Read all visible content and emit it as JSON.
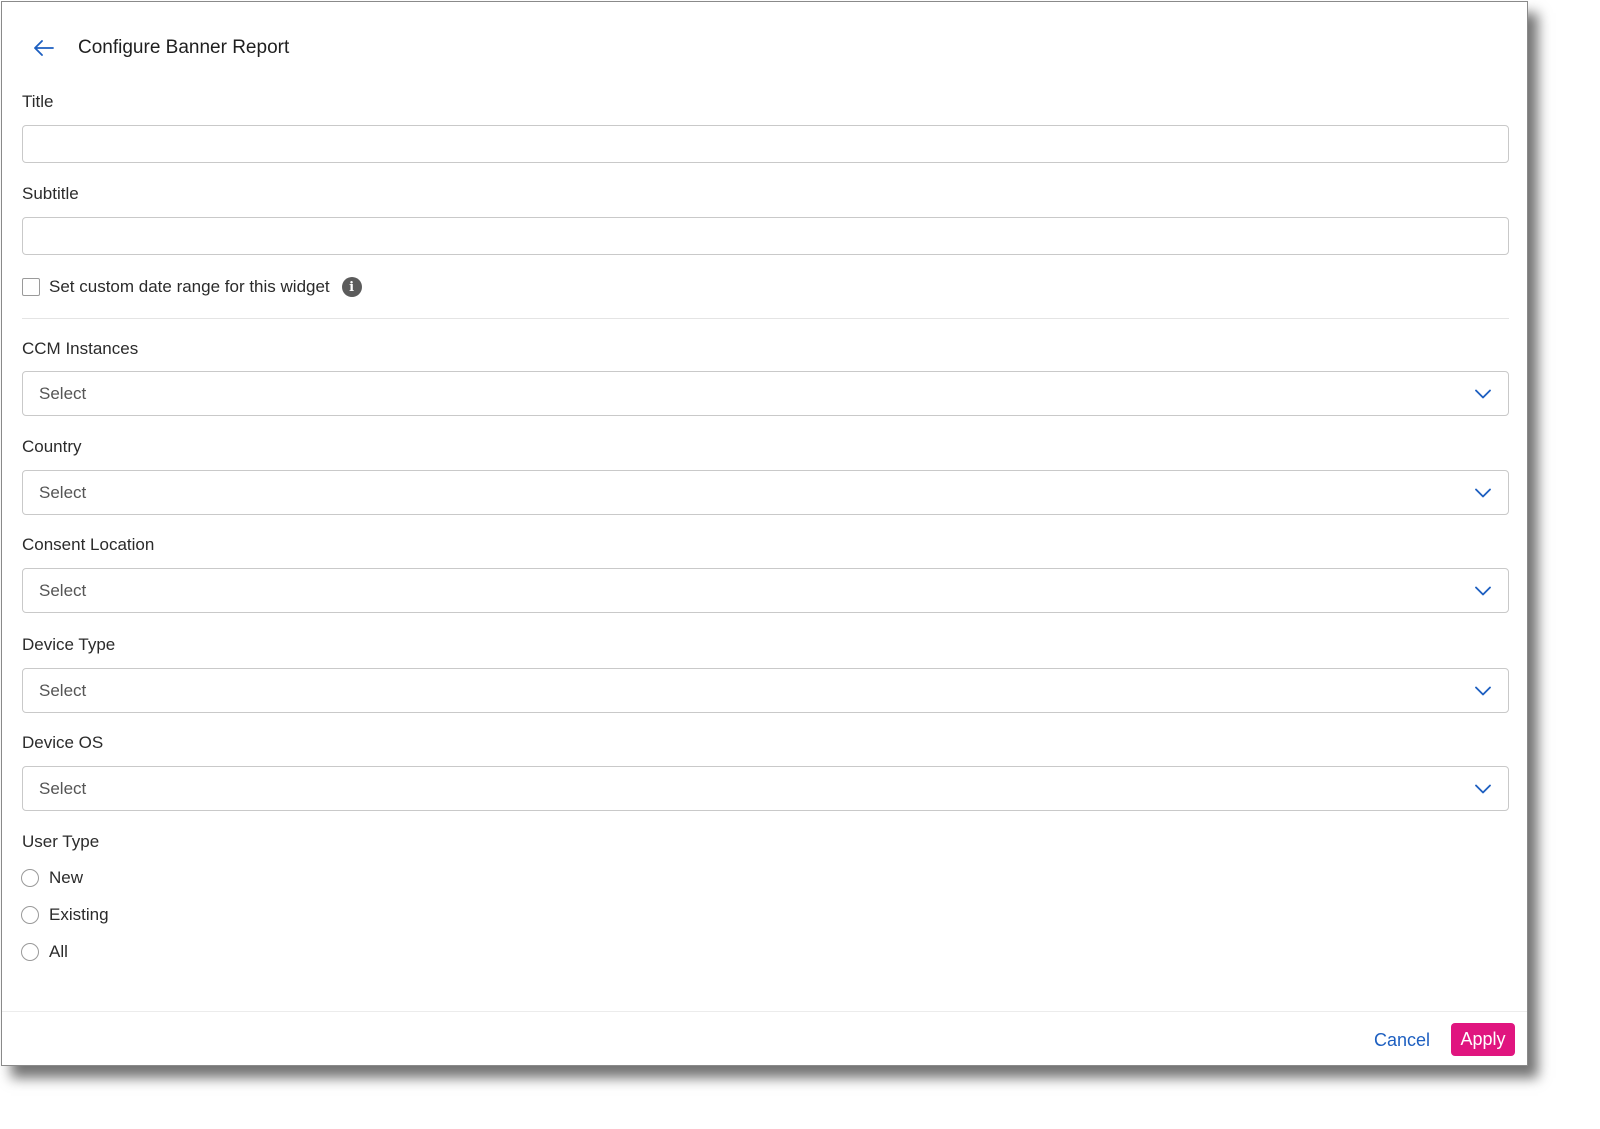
{
  "header": {
    "title": "Configure Banner Report"
  },
  "form": {
    "title_label": "Title",
    "title_value": "",
    "subtitle_label": "Subtitle",
    "subtitle_value": "",
    "custom_date_label": "Set custom date range for this widget",
    "custom_date_checked": false,
    "selects": [
      {
        "label": "CCM Instances",
        "value": "Select"
      },
      {
        "label": "Country",
        "value": "Select"
      },
      {
        "label": "Consent Location",
        "value": "Select"
      },
      {
        "label": "Device Type",
        "value": "Select"
      },
      {
        "label": "Device OS",
        "value": "Select"
      }
    ],
    "user_type_label": "User Type",
    "user_type_options": [
      "New",
      "Existing",
      "All"
    ]
  },
  "footer": {
    "cancel_label": "Cancel",
    "apply_label": "Apply"
  },
  "colors": {
    "accent": "#1d5fc0",
    "apply": "#e0157f",
    "border": "#c9c9c9"
  },
  "icons": {
    "back": "arrow-left-icon",
    "info": "info-icon",
    "chevron": "chevron-down-icon"
  }
}
